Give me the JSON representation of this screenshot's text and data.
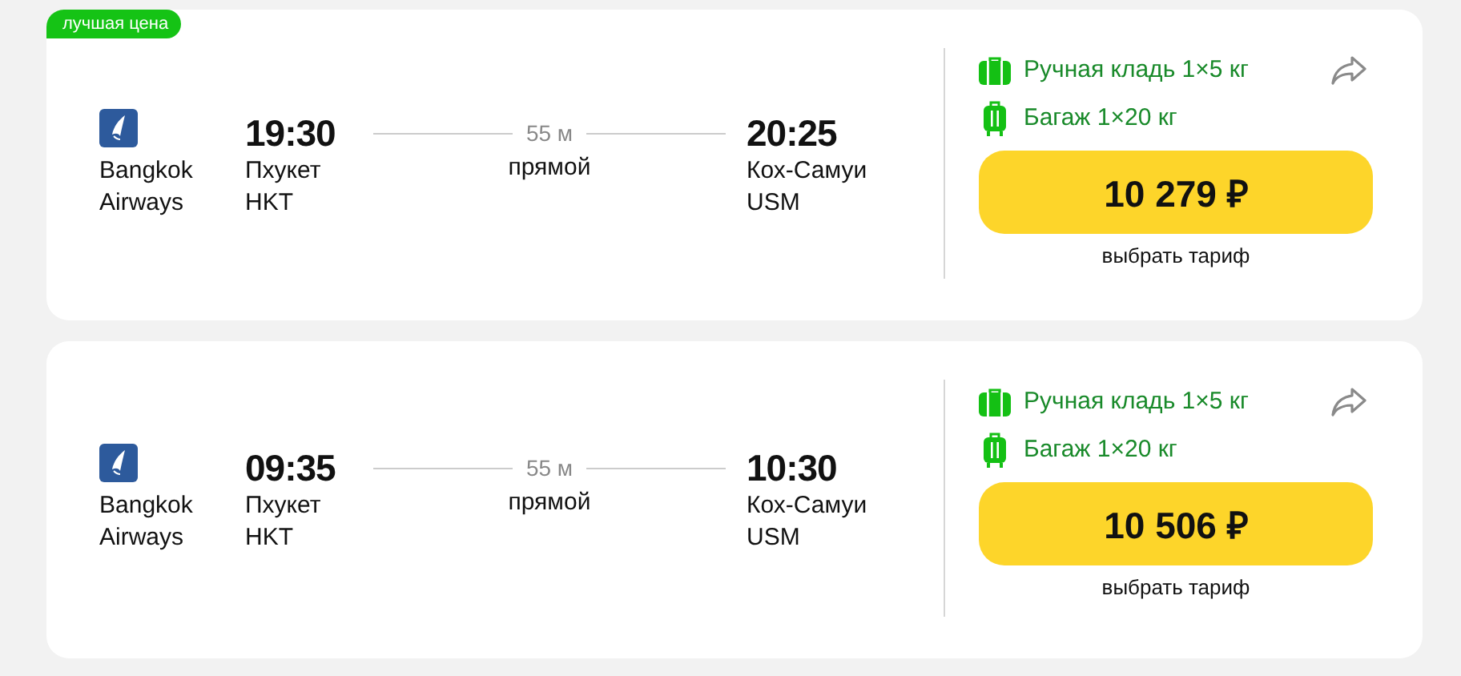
{
  "flights": [
    {
      "badge": "лучшая цена",
      "airline": [
        "Bangkok",
        "Airways"
      ],
      "depart": {
        "time": "19:30",
        "city": "Пхукет",
        "code": "HKT"
      },
      "duration": "55 м",
      "stops": "прямой",
      "arrive": {
        "time": "20:25",
        "city": "Кох-Самуи",
        "code": "USM"
      },
      "baggage": [
        {
          "kind": "hand",
          "text": "Ручная кладь 1×5 кг"
        },
        {
          "kind": "checked",
          "text": "Багаж 1×20 кг"
        }
      ],
      "price": "10 279 ₽",
      "fare_link": "выбрать тариф"
    },
    {
      "airline": [
        "Bangkok",
        "Airways"
      ],
      "depart": {
        "time": "09:35",
        "city": "Пхукет",
        "code": "HKT"
      },
      "duration": "55 м",
      "stops": "прямой",
      "arrive": {
        "time": "10:30",
        "city": "Кох-Самуи",
        "code": "USM"
      },
      "baggage": [
        {
          "kind": "hand",
          "text": "Ручная кладь 1×5 кг"
        },
        {
          "kind": "checked",
          "text": "Багаж 1×20 кг"
        }
      ],
      "price": "10 506 ₽",
      "fare_link": "выбрать тариф"
    }
  ]
}
